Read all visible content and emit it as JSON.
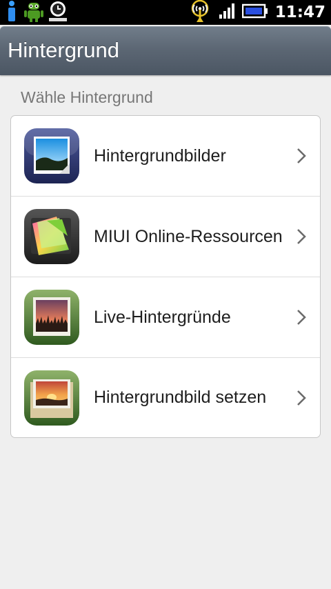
{
  "status_bar": {
    "time": "11:47",
    "icons": [
      "info-icon",
      "android-robot-icon",
      "clock-icon",
      "wifi-hotspot-icon",
      "signal-icon",
      "battery-icon"
    ]
  },
  "header": {
    "title": "Hintergrund"
  },
  "section": {
    "label": "Wähle Hintergrund"
  },
  "items": [
    {
      "label": "Hintergrundbilder",
      "icon": "wallpaper-picture-icon"
    },
    {
      "label": "MIUI Online-Ressourcen",
      "icon": "online-resources-icon"
    },
    {
      "label": "Live-Hintergründe",
      "icon": "live-wallpaper-icon"
    },
    {
      "label": "Hintergrundbild setzen",
      "icon": "set-wallpaper-icon"
    }
  ],
  "colors": {
    "titlebar": "#5c6774",
    "background": "#efefef",
    "text": "#1e1e1e",
    "section_label": "#777777"
  }
}
